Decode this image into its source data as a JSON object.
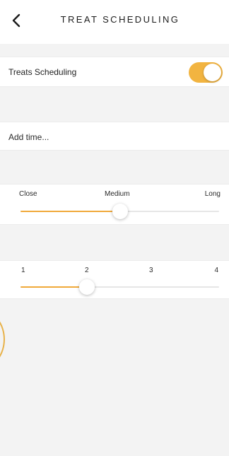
{
  "header": {
    "title": "TREAT SCHEDULING",
    "back_icon": "chevron-left-icon"
  },
  "schedule": {
    "label": "Treats Scheduling",
    "enabled": true,
    "toggle_color": "#f2b440"
  },
  "add_time": {
    "label": "Add time..."
  },
  "distance_slider": {
    "labels": [
      "Close",
      "Medium",
      "Long"
    ],
    "value_fraction": 0.5,
    "accent_color": "#f0a93a"
  },
  "count_slider": {
    "labels": [
      "1",
      "2",
      "3",
      "4"
    ],
    "min": 1,
    "max": 4,
    "value": 2,
    "accent_color": "#f0a93a"
  }
}
